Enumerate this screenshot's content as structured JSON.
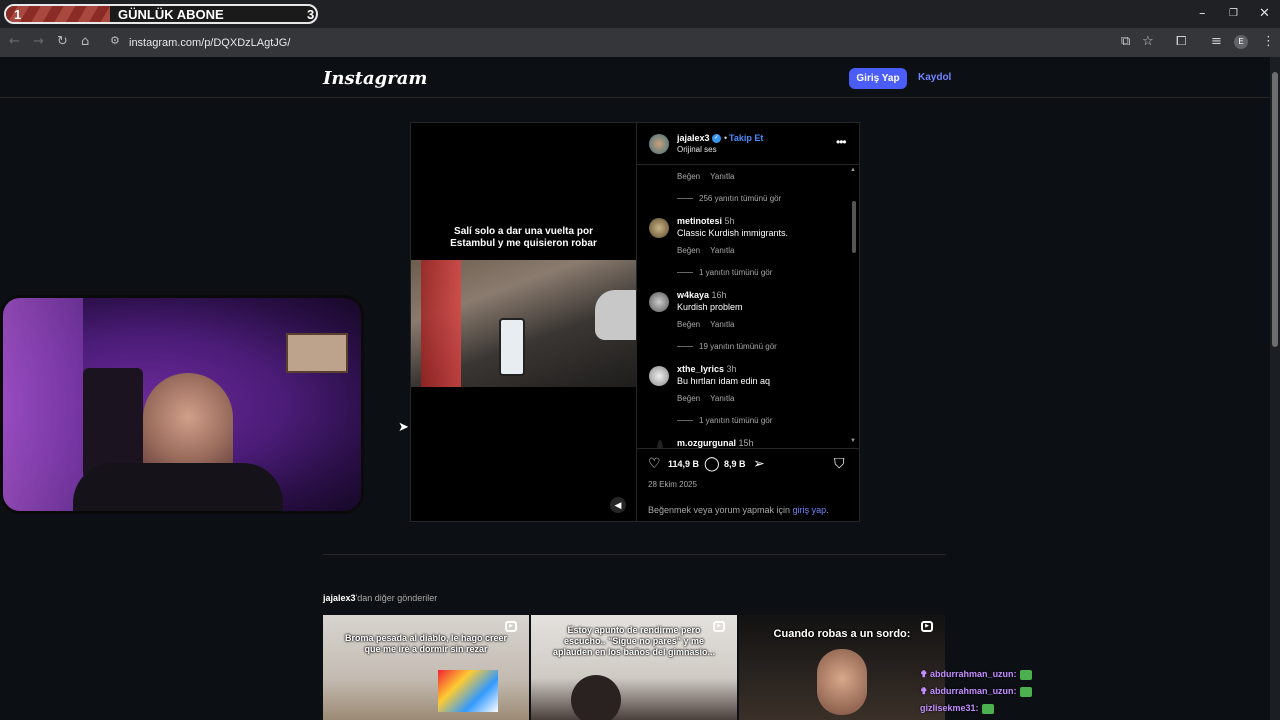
{
  "overlay": {
    "banner_left_num": "1",
    "banner_title": "GÜNLÜK ABONE",
    "banner_right_num": "3"
  },
  "browser": {
    "url": "instagram.com/p/DQXDzLAgtJG/",
    "icons": {
      "back": "arrow-left-icon",
      "forward": "arrow-right-icon",
      "reload": "reload-icon",
      "home": "home-icon",
      "site_info": "tune-icon",
      "install": "install-app-icon",
      "bookmark": "star-icon",
      "extensions": "puzzle-icon",
      "media": "media-control-icon",
      "menu": "kebab-icon"
    },
    "profile_initial": "E"
  },
  "header": {
    "logo": "Instagram",
    "login_label": "Giriş Yap",
    "signup_label": "Kaydol",
    "accent_color": "#4a5df9"
  },
  "post": {
    "caption_overlay": "Salí solo a dar una vuelta por Estambul y me quisieron robar",
    "username": "jajalex3",
    "follow_label": "Takip Et",
    "separator": "•",
    "audio_label": "Orijinal ses",
    "comments": [
      {
        "type": "actions",
        "like": "Beğen",
        "reply": "Yanıtla"
      },
      {
        "type": "replies",
        "text": "256 yanıtın tümünü gör"
      },
      {
        "type": "comment",
        "user": "metinotesi",
        "time": "5h",
        "text": "Classic Kurdish immigrants.",
        "like": "Beğen",
        "reply": "Yanıtla",
        "replies": "1 yanıtın tümünü gör"
      },
      {
        "type": "comment",
        "user": "w4kaya",
        "time": "16h",
        "text": "Kurdish problem",
        "like": "Beğen",
        "reply": "Yanıtla",
        "replies": "19 yanıtın tümünü gör"
      },
      {
        "type": "comment",
        "user": "xthe_lyrics",
        "time": "3h",
        "text": "Bu hırtları idam edin aq",
        "like": "Beğen",
        "reply": "Yanıtla",
        "replies": "1 yanıtın tümünü gör"
      },
      {
        "type": "comment",
        "user": "m.ozgurgunal",
        "time": "15h",
        "text": ""
      }
    ],
    "likes": "114,9 B",
    "comment_count": "8,9 B",
    "date": "28 Ekim 2025",
    "login_prompt_prefix": "Beğenmek veya yorum yapmak için ",
    "login_prompt_link": "giriş yap",
    "login_prompt_suffix": "."
  },
  "more_posts": {
    "user": "jajalex3",
    "suffix": "'dan diğer gönderiler",
    "thumbs": [
      {
        "text": "Broma pesada al diablo, le hago creer que me iré a dormir sin rezar"
      },
      {
        "text": "Estoy apunto de rendirme pero escucho.. \"Sigue no pares\" y me aplauden en los baños del gimnasio..."
      },
      {
        "text": "Cuando robas a un sordo:"
      }
    ]
  },
  "chat": [
    {
      "user": "abdurrahman_uzun:"
    },
    {
      "user": "abdurrahman_uzun:"
    },
    {
      "user": "gizlisekme31:"
    }
  ]
}
